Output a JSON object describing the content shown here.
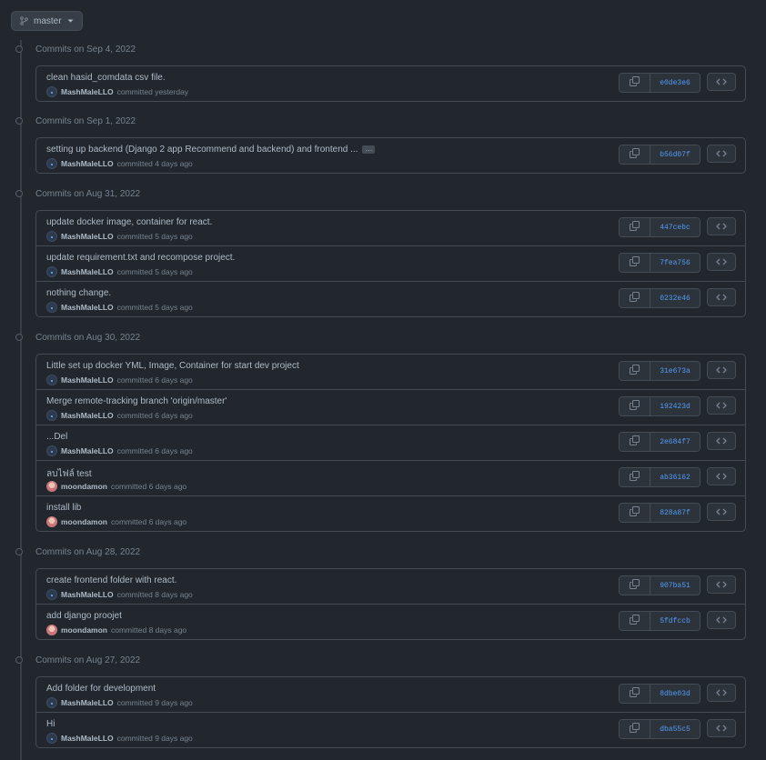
{
  "branch": {
    "name": "master",
    "icon": "git-branch-icon"
  },
  "groups": [
    {
      "date": "Commits on Sep 4, 2022",
      "commits": [
        {
          "message": "clean hasid_comdata csv file.",
          "author": "MashMaleLLO",
          "avatar": "blue",
          "time": "committed yesterday",
          "sha": "e0de3e6"
        }
      ]
    },
    {
      "date": "Commits on Sep 1, 2022",
      "commits": [
        {
          "message": "setting up backend (Django 2 app Recommend and backend) and frontend ...",
          "author": "MashMaleLLO",
          "avatar": "blue",
          "time": "committed 4 days ago",
          "sha": "b56d07f",
          "expand": "…"
        }
      ]
    },
    {
      "date": "Commits on Aug 31, 2022",
      "commits": [
        {
          "message": "update docker image, container for react.",
          "author": "MashMaleLLO",
          "avatar": "blue",
          "time": "committed 5 days ago",
          "sha": "447cebc"
        },
        {
          "message": "update requirement.txt and recompose project.",
          "author": "MashMaleLLO",
          "avatar": "blue",
          "time": "committed 5 days ago",
          "sha": "7fea756"
        },
        {
          "message": "nothing change.",
          "author": "MashMaleLLO",
          "avatar": "blue",
          "time": "committed 5 days ago",
          "sha": "0232e46"
        }
      ]
    },
    {
      "date": "Commits on Aug 30, 2022",
      "commits": [
        {
          "message": "Little set up docker YML, Image, Container for start dev project",
          "author": "MashMaleLLO",
          "avatar": "blue",
          "time": "committed 6 days ago",
          "sha": "31e673a"
        },
        {
          "message": "Merge remote-tracking branch 'origin/master'",
          "author": "MashMaleLLO",
          "avatar": "blue",
          "time": "committed 6 days ago",
          "sha": "192423d"
        },
        {
          "message": "...Del",
          "author": "MashMaleLLO",
          "avatar": "blue",
          "time": "committed 6 days ago",
          "sha": "2e684f7"
        },
        {
          "message": "ลบไฟล์ test",
          "author": "moondamon",
          "avatar": "pink",
          "time": "committed 6 days ago",
          "sha": "ab36162"
        },
        {
          "message": "install lib",
          "author": "moondamon",
          "avatar": "pink",
          "time": "committed 6 days ago",
          "sha": "828a87f"
        }
      ]
    },
    {
      "date": "Commits on Aug 28, 2022",
      "commits": [
        {
          "message": "create frontend folder with react.",
          "author": "MashMaleLLO",
          "avatar": "blue",
          "time": "committed 8 days ago",
          "sha": "907ba51"
        },
        {
          "message": "add django proojet",
          "author": "moondamon",
          "avatar": "pink",
          "time": "committed 8 days ago",
          "sha": "5fdfccb"
        }
      ]
    },
    {
      "date": "Commits on Aug 27, 2022",
      "commits": [
        {
          "message": "Add folder for development",
          "author": "MashMaleLLO",
          "avatar": "blue",
          "time": "committed 9 days ago",
          "sha": "8dbe03d"
        },
        {
          "message": "Hi",
          "author": "MashMaleLLO",
          "avatar": "blue",
          "time": "committed 9 days ago",
          "sha": "dba55c5"
        }
      ]
    }
  ],
  "icons": {
    "commit": "commit-dot-icon",
    "copy": "copy-icon",
    "browse": "code-icon",
    "caret": "caret-down-icon"
  },
  "colors": {
    "background": "#22272e",
    "border": "#444c56",
    "link": "#539bf5",
    "muted": "#768390"
  }
}
